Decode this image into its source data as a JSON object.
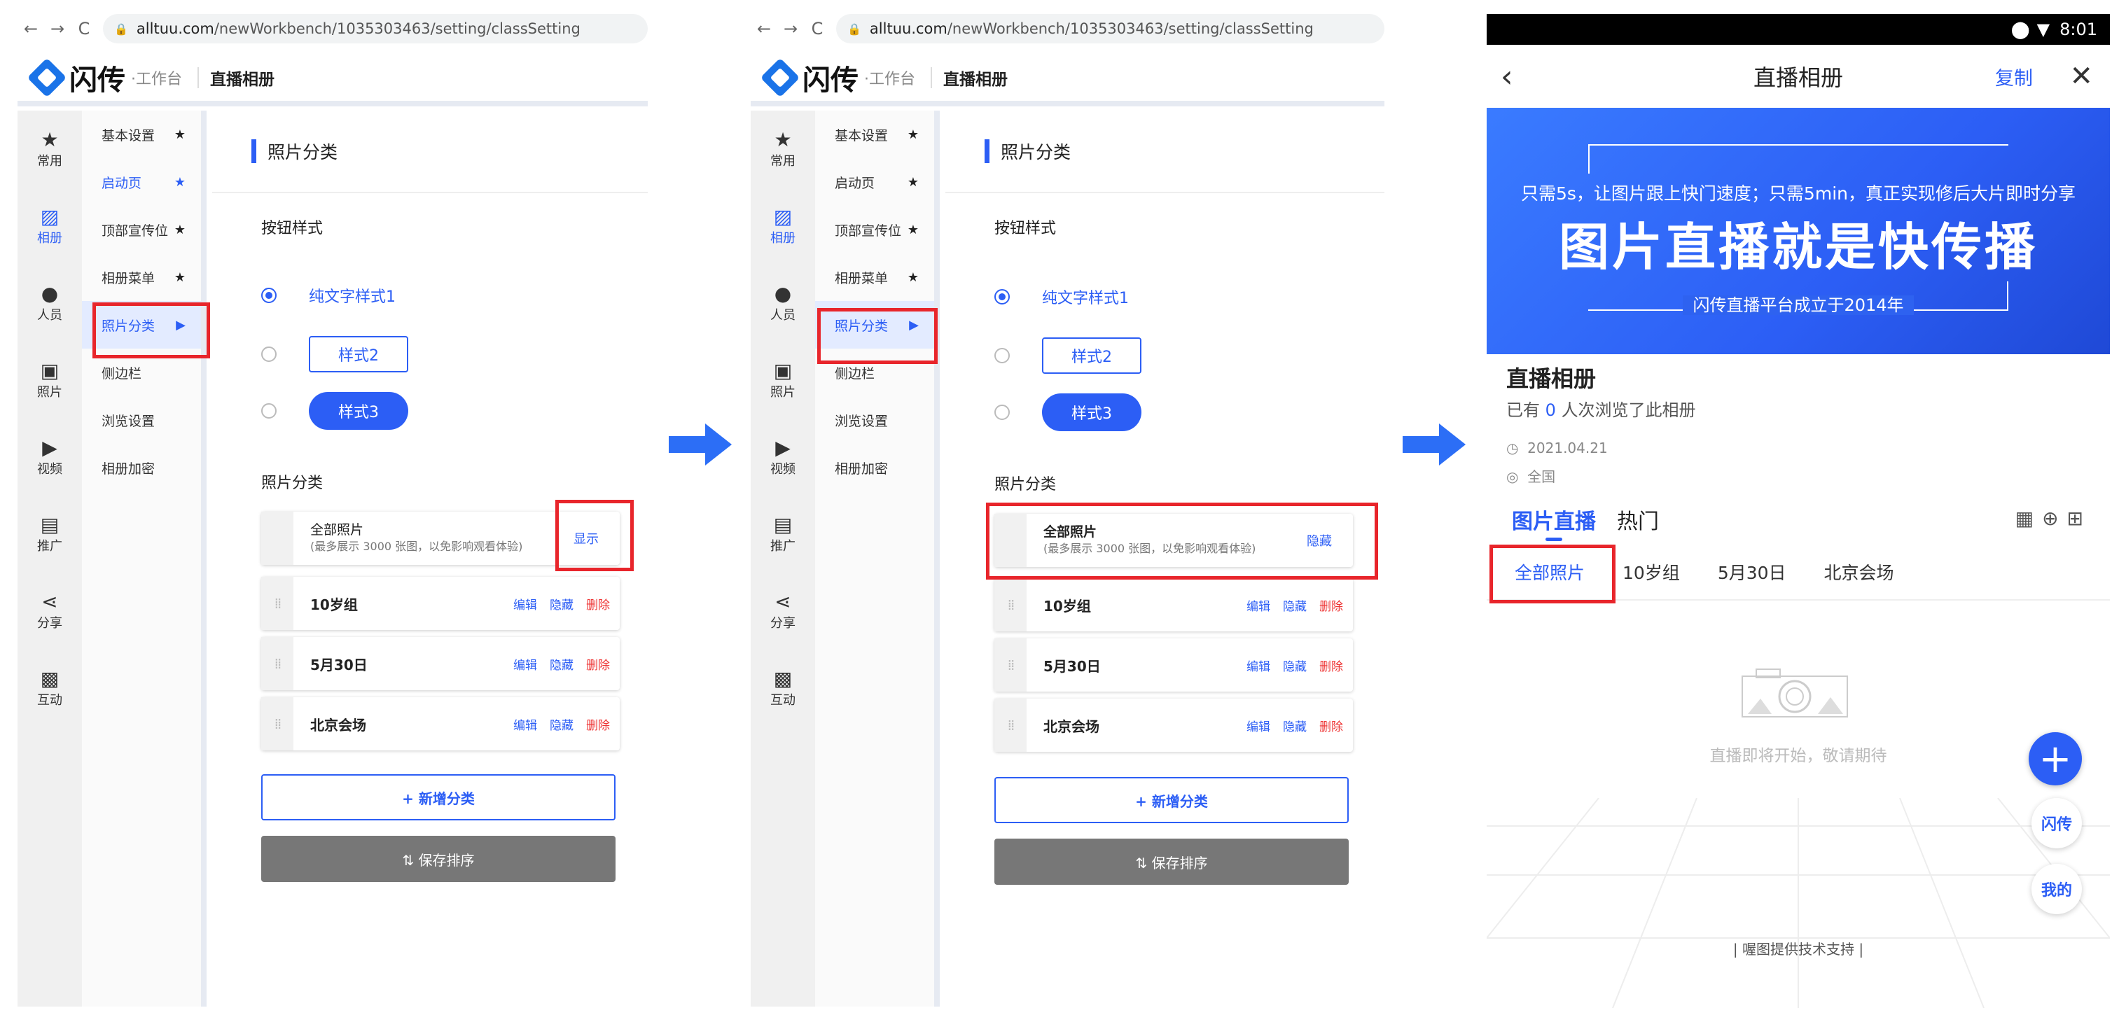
{
  "browser": {
    "url_host": "alltuu.com",
    "url_path": "/newWorkbench/1035303463/setting/classSetting"
  },
  "app": {
    "logo": "闪传",
    "logo_sub": "·工作台",
    "page_title": "直播相册"
  },
  "iconbar": [
    "常用",
    "相册",
    "人员",
    "照片",
    "视频",
    "推广",
    "分享",
    "互动"
  ],
  "menu": [
    "基本设置",
    "启动页",
    "顶部宣传位",
    "相册菜单",
    "照片分类",
    "侧边栏",
    "浏览设置",
    "相册加密"
  ],
  "content": {
    "section_title": "照片分类",
    "button_style_label": "按钮样式",
    "style1": "纯文字样式1",
    "style2": "样式2",
    "style3": "样式3",
    "category_label": "照片分类",
    "all_photos": "全部照片",
    "all_photos_note": "(最多展示 3000 张图，以免影响观看体验)",
    "show": "显示",
    "hide": "隐藏",
    "edit": "编辑",
    "delete": "删除",
    "categories": [
      "10岁组",
      "5月30日",
      "北京会场"
    ],
    "add_category": "+ 新增分类",
    "save_order": "⇅ 保存排序"
  },
  "phone": {
    "time": "8:01",
    "title": "直播相册",
    "copy": "复制",
    "banner_top": "只需5s，让图片跟上快门速度；只需5min，真正实现修后大片即时分享",
    "banner_main": "图片直播就是快传播",
    "banner_bottom": "闪传直播平台成立于2014年",
    "album_name": "直播相册",
    "views_prefix": "已有",
    "views_count": "0",
    "views_suffix": "人次浏览了此相册",
    "date": "2021.04.21",
    "location": "全国",
    "tabs": [
      "图片直播",
      "热门"
    ],
    "subtabs": [
      "全部照片",
      "10岁组",
      "5月30日",
      "北京会场"
    ],
    "empty": "直播即将开始，敬请期待",
    "fab_brand": "闪传",
    "fab_mine": "我的",
    "footer": "| 喔图提供技术支持 |"
  },
  "colors": {
    "accent": "#2c5ef5",
    "highlight": "#e8252b",
    "danger": "#e33"
  }
}
